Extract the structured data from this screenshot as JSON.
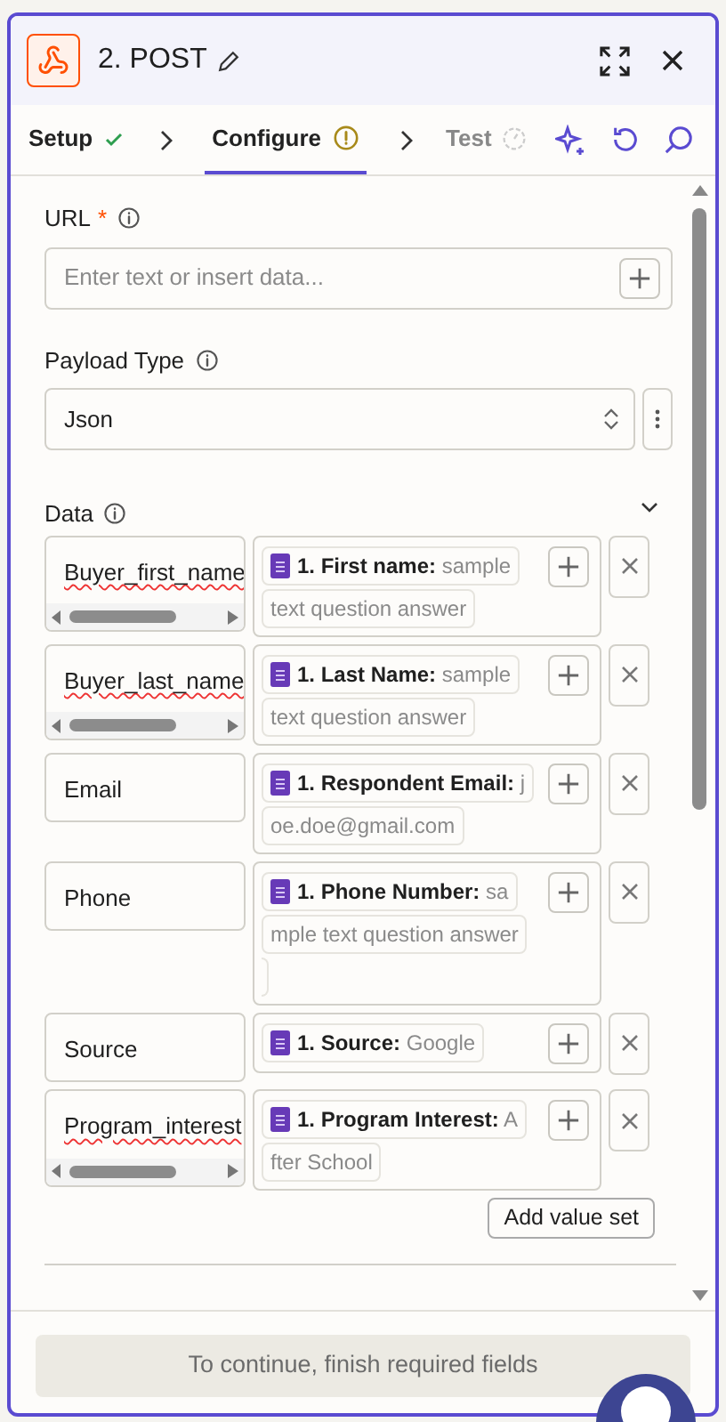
{
  "header": {
    "title": "2. POST"
  },
  "tabs": [
    {
      "label": "Setup",
      "kind": "done",
      "selected": false
    },
    {
      "label": "Configure",
      "kind": "warning",
      "selected": true
    },
    {
      "label": "Test",
      "kind": "pending",
      "selected": false
    }
  ],
  "url": {
    "label": "URL",
    "required_mark": "*",
    "placeholder": "Enter text or insert data..."
  },
  "payload_type": {
    "label": "Payload Type",
    "value": "Json"
  },
  "data": {
    "label": "Data",
    "expanded": true,
    "rows": [
      {
        "key": "Buyer_first_name",
        "misspelled": true,
        "scrollbar": true,
        "field": "1. First name:",
        "sample": "sample",
        "continuation": "text question answer",
        "extra_line": false
      },
      {
        "key": "Buyer_last_name",
        "misspelled": true,
        "scrollbar": true,
        "field": "1. Last Name:",
        "sample": "sample",
        "continuation": "text question answer",
        "extra_line": false
      },
      {
        "key": "Email",
        "misspelled": false,
        "scrollbar": false,
        "field": "1. Respondent Email:",
        "sample": "j",
        "continuation": "oe.doe@gmail.com",
        "extra_line": false
      },
      {
        "key": "Phone",
        "misspelled": false,
        "scrollbar": false,
        "field": "1. Phone Number:",
        "sample": "sa",
        "continuation": "mple text question answer",
        "extra_line": true
      },
      {
        "key": "Source",
        "misspelled": false,
        "scrollbar": false,
        "field": "1. Source:",
        "sample": "Google",
        "extra_line": false
      },
      {
        "key": "Program_interest",
        "misspelled": true,
        "scrollbar": true,
        "field": "1. Program Interest:",
        "sample": "A",
        "continuation": "fter School",
        "extra_line": false
      }
    ],
    "add_button": "Add value set"
  },
  "footer": {
    "button": "To continue, finish required fields",
    "disabled": true
  }
}
